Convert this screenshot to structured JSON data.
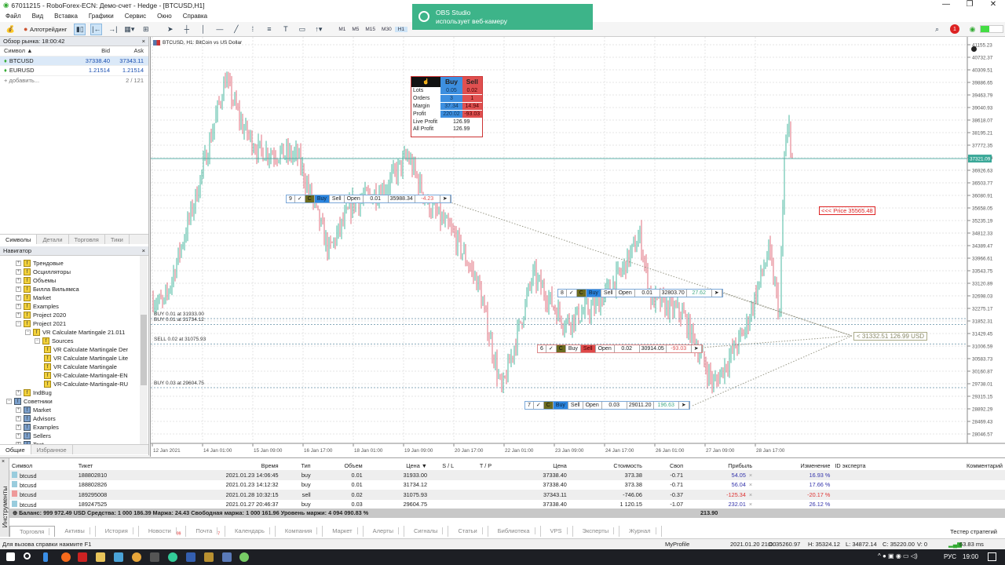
{
  "window": {
    "title": "67011215 - RoboForex-ECN: Демо-счет - Hedge - [BTCUSD,H1]",
    "min": "—",
    "max": "❐",
    "close": "✕"
  },
  "menu": [
    "Файл",
    "Вид",
    "Вставка",
    "Графики",
    "Сервис",
    "Окно",
    "Справка"
  ],
  "toolbar": {
    "algo_label": "Алготрейдинг",
    "timeframes": [
      "M1",
      "M5",
      "M15",
      "M30",
      "H1"
    ],
    "selected_tf": "H1",
    "notif_count": "1"
  },
  "obs": {
    "title": "OBS Studio",
    "text": "использует веб-камеру"
  },
  "market_watch": {
    "title": "Обзор рынка: 18:00:42",
    "cols": [
      "Символ ▲",
      "Bid",
      "Ask"
    ],
    "rows": [
      {
        "symbol": "BTCUSD",
        "bid": "37338.40",
        "ask": "37343.11"
      },
      {
        "symbol": "EURUSD",
        "bid": "1.21514",
        "ask": "1.21514"
      }
    ],
    "add": "+ добавить...",
    "count": "2 / 121",
    "tabs": [
      "Символы",
      "Детали",
      "Торговля",
      "Тики"
    ]
  },
  "navigator": {
    "title": "Навигатор",
    "items": [
      {
        "label": "Трендовые",
        "lvl": 2,
        "t": "i"
      },
      {
        "label": "Осцилляторы",
        "lvl": 2,
        "t": "i"
      },
      {
        "label": "Объемы",
        "lvl": 2,
        "t": "i"
      },
      {
        "label": "Билла Вильямса",
        "lvl": 2,
        "t": "i"
      },
      {
        "label": "Market",
        "lvl": 2,
        "t": "i"
      },
      {
        "label": "Examples",
        "lvl": 2,
        "t": "i"
      },
      {
        "label": "Project 2020",
        "lvl": 2,
        "t": "i"
      },
      {
        "label": "Project 2021",
        "lvl": 2,
        "t": "i"
      },
      {
        "label": "VR Calculate Martingale 21.011",
        "lvl": 3,
        "t": "i"
      },
      {
        "label": "Sources",
        "lvl": 4,
        "t": "i"
      },
      {
        "label": "VR Calculate Martingale Der",
        "lvl": 5,
        "t": "i"
      },
      {
        "label": "VR Calculate Martingale Lite",
        "lvl": 5,
        "t": "i"
      },
      {
        "label": "VR Calculate Martingale",
        "lvl": 5,
        "t": "i"
      },
      {
        "label": "VR-Calculate-Martingale-EN",
        "lvl": 5,
        "t": "i"
      },
      {
        "label": "VR-Calculate-Martingale-RU",
        "lvl": 5,
        "t": "i"
      },
      {
        "label": "IndBug",
        "lvl": 2,
        "t": "i"
      },
      {
        "label": "Советники",
        "lvl": 1,
        "t": "e"
      },
      {
        "label": "Market",
        "lvl": 2,
        "t": "e"
      },
      {
        "label": "Advisors",
        "lvl": 2,
        "t": "e"
      },
      {
        "label": "Examples",
        "lvl": 2,
        "t": "e"
      },
      {
        "label": "Sellers",
        "lvl": 2,
        "t": "e"
      },
      {
        "label": "Test",
        "lvl": 2,
        "t": "e"
      }
    ],
    "tabs": [
      "Общие",
      "Избранное"
    ]
  },
  "chart": {
    "header": "BTCUSD, H1:  BitCoin vs US Dollar",
    "bid_label": "37321.09",
    "price_label": "<<< Price 35565.48",
    "target_label": "< 31332.51  126.99 USD",
    "levels": [
      {
        "label": "BUY 0.01 at 31933.00",
        "price": 31933.0
      },
      {
        "label": "BUY 0.01 at 31734.12",
        "price": 31734.12
      },
      {
        "label": "SELL 0.02 at 31075.93",
        "price": 31075.93
      },
      {
        "label": "BUY 0.03 at 29604.75",
        "price": 29604.75
      }
    ],
    "panels": [
      {
        "n": "9",
        "side": "buy",
        "buy": "Buy",
        "sell": "Sell",
        "open": "Open",
        "lots": "0.01",
        "price": "35988.34",
        "profit": "-4.23",
        "pc": "#d55"
      },
      {
        "n": "8",
        "side": "buy",
        "buy": "Buy",
        "sell": "Sell",
        "open": "Open",
        "lots": "0.01",
        "price": "32803.70",
        "profit": "27.62",
        "pc": "#4a8"
      },
      {
        "n": "6",
        "side": "sell",
        "buy": "Buy",
        "sell": "Sell",
        "open": "Open",
        "lots": "0.02",
        "price": "30914.05",
        "profit": "-93.03",
        "pc": "#d55"
      },
      {
        "n": "7",
        "side": "buy",
        "buy": "Buy",
        "sell": "Sell",
        "open": "Open",
        "lots": "0.03",
        "price": "29011.20",
        "profit": "196.63",
        "pc": "#4a8"
      }
    ],
    "dashboard": {
      "buy": "Buy",
      "sell": "Sell",
      "rows": [
        [
          "Lots",
          "0.05",
          "0.02"
        ],
        [
          "Orders",
          "3",
          "1"
        ],
        [
          "Margin",
          "37.34",
          "14.94"
        ],
        [
          "Profit",
          "220.02",
          "-93.03"
        ]
      ],
      "live_label": "Live Profit",
      "live": "126.99",
      "all_label": "All Profit",
      "all": "126.99"
    }
  },
  "chart_data": {
    "type": "candlestick",
    "symbol": "BTCUSD",
    "timeframe": "H1",
    "bid": 37321.09,
    "ylim": [
      28046.57,
      41155.23
    ],
    "yticks": [
      "41155.23",
      "40732.37",
      "40309.51",
      "39886.65",
      "39463.79",
      "39040.93",
      "38618.07",
      "38195.21",
      "37772.35",
      "37349.49",
      "36926.63",
      "36503.77",
      "36080.91",
      "35658.05",
      "35235.19",
      "34812.33",
      "34389.47",
      "33966.61",
      "33543.75",
      "33120.89",
      "32698.03",
      "32275.17",
      "31852.31",
      "31429.45",
      "31006.59",
      "30583.73",
      "30160.87",
      "29738.01",
      "29315.15",
      "28892.29",
      "28469.43",
      "28046.57"
    ],
    "xticks": [
      "12 Jan 2021",
      "14 Jan 01:00",
      "15 Jan 09:00",
      "16 Jan 17:00",
      "18 Jan 01:00",
      "19 Jan 09:00",
      "20 Jan 17:00",
      "22 Jan 01:00",
      "23 Jan 09:00",
      "24 Jan 17:00",
      "26 Jan 01:00",
      "27 Jan 09:00",
      "28 Jan 17:00"
    ],
    "hours_per_xtick": 32,
    "price_path": [
      [
        0,
        32600
      ],
      [
        8,
        32400
      ],
      [
        28,
        36000
      ],
      [
        47,
        40000
      ],
      [
        58,
        38400
      ],
      [
        68,
        37600
      ],
      [
        93,
        37400
      ],
      [
        113,
        34200
      ],
      [
        128,
        35800
      ],
      [
        148,
        36300
      ],
      [
        163,
        37400
      ],
      [
        176,
        35800
      ],
      [
        193,
        34700
      ],
      [
        208,
        33100
      ],
      [
        223,
        29450
      ],
      [
        243,
        33400
      ],
      [
        263,
        31800
      ],
      [
        283,
        32350
      ],
      [
        298,
        33400
      ],
      [
        311,
        34700
      ],
      [
        318,
        32600
      ],
      [
        338,
        32100
      ],
      [
        358,
        29700
      ],
      [
        378,
        31550
      ],
      [
        393,
        34200
      ],
      [
        400,
        32100
      ],
      [
        403,
        37400
      ],
      [
        406,
        38400
      ],
      [
        408,
        37300
      ]
    ]
  },
  "trades": {
    "cols": [
      "Символ",
      "Тикет",
      "Время",
      "Тип",
      "Объем",
      "Цена ▼",
      "S / L",
      "T / P",
      "Цена",
      "Стоимость",
      "Своп",
      "Прибыль",
      "Изменение",
      "ID эксперта",
      "Комментарий"
    ],
    "rows": [
      {
        "symbol": "btcusd",
        "ticket": "188802810",
        "time": "2021.01.23 14:06:45",
        "type": "buy",
        "vol": "0.01",
        "price": "31933.00",
        "cur": "37338.40",
        "cost": "373.38",
        "swap": "-0.71",
        "profit": "54.05",
        "change": "16.93 %",
        "neg": false
      },
      {
        "symbol": "btcusd",
        "ticket": "188802826",
        "time": "2021.01.23 14:12:32",
        "type": "buy",
        "vol": "0.01",
        "price": "31734.12",
        "cur": "37338.40",
        "cost": "373.38",
        "swap": "-0.71",
        "profit": "56.04",
        "change": "17.66 %",
        "neg": false
      },
      {
        "symbol": "btcusd",
        "ticket": "189295008",
        "time": "2021.01.28 10:32:15",
        "type": "sell",
        "vol": "0.02",
        "price": "31075.93",
        "cur": "37343.11",
        "cost": "-746.06",
        "swap": "-0.37",
        "profit": "-125.34",
        "change": "-20.17 %",
        "neg": true
      },
      {
        "symbol": "btcusd",
        "ticket": "189247525",
        "time": "2021.01.27 20:46:37",
        "type": "buy",
        "vol": "0.03",
        "price": "29604.75",
        "cur": "37338.40",
        "cost": "1 120.15",
        "swap": "-1.07",
        "profit": "232.01",
        "change": "26.12 %",
        "neg": false
      }
    ],
    "balance": "Баланс: 999 972.49 USD  Средства: 1 000 186.39  Маржа: 24.43  Свободная маржа: 1 000 161.96  Уровень маржи: 4 094 090.83 %",
    "total": "213.90",
    "side_label": "Инструменты",
    "tabs": [
      "Торговля",
      "Активы",
      "История",
      "Новости",
      "Почта",
      "Календарь",
      "Компания",
      "Маркет",
      "Алерты",
      "Сигналы",
      "Статьи",
      "Библиотека",
      "VPS",
      "Эксперты",
      "Журнал"
    ],
    "news_badge": "99",
    "mail_badge": "7",
    "tester": "Тестер стратегий"
  },
  "status": {
    "help": "Для вызова справки нажмите F1",
    "profile": "MyProfile",
    "time": "2021.01.20 21:00",
    "o": "O: 35260.97",
    "h": "H: 35324.12",
    "l": "L: 34872.14",
    "c": "C: 35220.00",
    "v": "V: 0",
    "ping": "63.83 ms"
  },
  "taskbar": {
    "lang": "РУС",
    "clock": "19:00"
  }
}
